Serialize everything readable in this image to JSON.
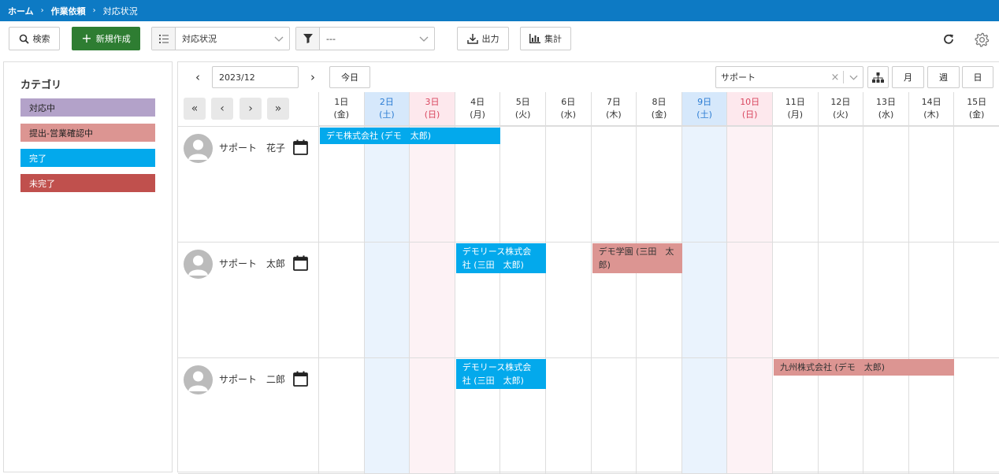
{
  "breadcrumb": [
    "ホーム",
    "作業依頼",
    "対応状況"
  ],
  "toolbar": {
    "search_label": "検索",
    "new_label": "新規作成",
    "view_select": "対応状況",
    "filter_select": "---",
    "export_label": "出力",
    "aggregate_label": "集計"
  },
  "categories": {
    "title": "カテゴリ",
    "items": [
      {
        "label": "対応中",
        "color": "#b3a2c9"
      },
      {
        "label": "提出-営業確認中",
        "color": "#dc9592"
      },
      {
        "label": "完了",
        "color": "#03a9ec"
      },
      {
        "label": "未完了",
        "color": "#c0504d"
      }
    ]
  },
  "calendar": {
    "month": "2023/12",
    "today_label": "今日",
    "user_filter": "サポート",
    "view_month": "月",
    "view_week": "週",
    "view_day": "日",
    "days": [
      {
        "d": "1日",
        "w": "(金)",
        "type": ""
      },
      {
        "d": "2日",
        "w": "(土)",
        "type": "sat"
      },
      {
        "d": "3日",
        "w": "(日)",
        "type": "sun"
      },
      {
        "d": "4日",
        "w": "(月)",
        "type": ""
      },
      {
        "d": "5日",
        "w": "(火)",
        "type": ""
      },
      {
        "d": "6日",
        "w": "(水)",
        "type": ""
      },
      {
        "d": "7日",
        "w": "(木)",
        "type": ""
      },
      {
        "d": "8日",
        "w": "(金)",
        "type": ""
      },
      {
        "d": "9日",
        "w": "(土)",
        "type": "sat"
      },
      {
        "d": "10日",
        "w": "(日)",
        "type": "sun"
      },
      {
        "d": "11日",
        "w": "(月)",
        "type": ""
      },
      {
        "d": "12日",
        "w": "(火)",
        "type": ""
      },
      {
        "d": "13日",
        "w": "(水)",
        "type": ""
      },
      {
        "d": "14日",
        "w": "(木)",
        "type": ""
      },
      {
        "d": "15日",
        "w": "(金)",
        "type": ""
      }
    ],
    "users": [
      {
        "name": "サポート　花子",
        "events": [
          {
            "title": "デモ株式会社 (デモ　太郎)",
            "start": 0,
            "span": 4,
            "status": "done"
          }
        ]
      },
      {
        "name": "サポート　太郎",
        "events": [
          {
            "title": "デモリース株式会社 (三田　太郎)",
            "start": 3,
            "span": 2,
            "status": "done"
          },
          {
            "title": "デモ学園 (三田　太郎)",
            "start": 6,
            "span": 2,
            "status": "submit"
          }
        ]
      },
      {
        "name": "サポート　二郎",
        "events": [
          {
            "title": "デモリース株式会社 (三田　太郎)",
            "start": 3,
            "span": 2,
            "status": "done"
          },
          {
            "title": "九州株式会社 (デモ　太郎)",
            "start": 10,
            "span": 4,
            "status": "submit"
          }
        ]
      }
    ]
  }
}
